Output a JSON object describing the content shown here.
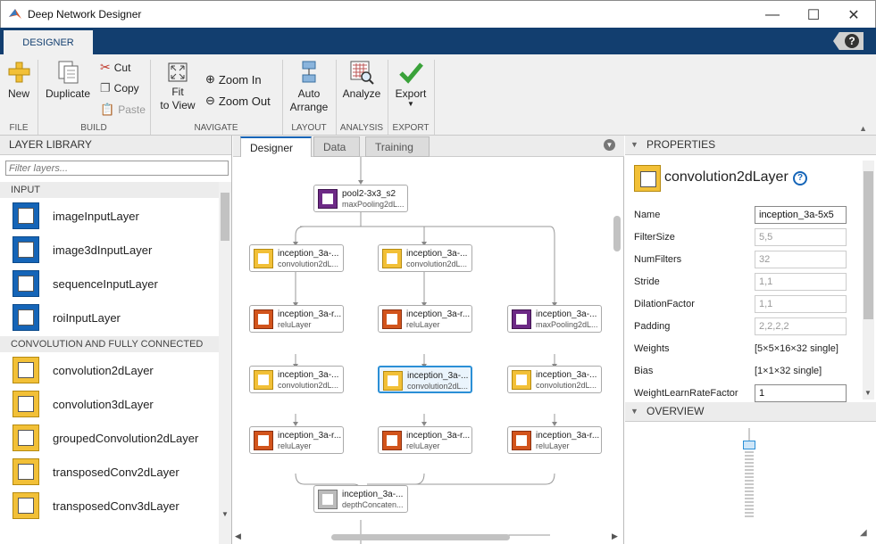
{
  "window": {
    "title": "Deep Network Designer",
    "min": "—",
    "max": "☐",
    "close": "✕"
  },
  "ribbon": {
    "tab": "DESIGNER",
    "help": "?",
    "file": {
      "new": "New",
      "section": "FILE"
    },
    "build": {
      "duplicate": "Duplicate",
      "cut": "Cut",
      "copy": "Copy",
      "paste": "Paste",
      "section": "BUILD"
    },
    "navigate": {
      "fit1": "Fit",
      "fit2": "to View",
      "zoom_in": "Zoom In",
      "zoom_out": "Zoom Out",
      "section": "NAVIGATE"
    },
    "layout": {
      "auto1": "Auto",
      "auto2": "Arrange",
      "section": "LAYOUT"
    },
    "analysis": {
      "analyze": "Analyze",
      "section": "ANALYSIS"
    },
    "export": {
      "export": "Export",
      "section": "EXPORT"
    }
  },
  "library": {
    "header": "LAYER LIBRARY",
    "filter_placeholder": "Filter layers...",
    "categories": [
      {
        "name": "INPUT"
      },
      {
        "name": "CONVOLUTION AND FULLY CONNECTED"
      }
    ],
    "items": [
      {
        "label": "imageInputLayer",
        "color": "blue"
      },
      {
        "label": "image3dInputLayer",
        "color": "blue"
      },
      {
        "label": "sequenceInputLayer",
        "color": "blue"
      },
      {
        "label": "roiInputLayer",
        "color": "blue"
      },
      {
        "label": "convolution2dLayer",
        "color": "yellow"
      },
      {
        "label": "convolution3dLayer",
        "color": "yellow"
      },
      {
        "label": "groupedConvolution2dLayer",
        "color": "yellow"
      },
      {
        "label": "transposedConv2dLayer",
        "color": "yellow"
      },
      {
        "label": "transposedConv3dLayer",
        "color": "yellow"
      }
    ]
  },
  "canvas": {
    "tabs": [
      {
        "label": "Designer"
      },
      {
        "label": "Data"
      },
      {
        "label": "Training"
      }
    ],
    "nodes": [
      {
        "name": "pool2-3x3_s2",
        "type": "maxPooling2dL...",
        "kind": "pool"
      },
      {
        "name": "inception_3a-...",
        "type": "convolution2dL...",
        "kind": "conv"
      },
      {
        "name": "inception_3a-...",
        "type": "convolution2dL...",
        "kind": "conv"
      },
      {
        "name": "inception_3a-r...",
        "type": "reluLayer",
        "kind": "relu"
      },
      {
        "name": "inception_3a-r...",
        "type": "reluLayer",
        "kind": "relu"
      },
      {
        "name": "inception_3a-...",
        "type": "maxPooling2dL...",
        "kind": "pool"
      },
      {
        "name": "inception_3a-...",
        "type": "convolution2dL...",
        "kind": "conv"
      },
      {
        "name": "inception_3a-...",
        "type": "convolution2dL...",
        "kind": "conv",
        "selected": true
      },
      {
        "name": "inception_3a-...",
        "type": "convolution2dL...",
        "kind": "conv"
      },
      {
        "name": "inception_3a-r...",
        "type": "reluLayer",
        "kind": "relu"
      },
      {
        "name": "inception_3a-r...",
        "type": "reluLayer",
        "kind": "relu"
      },
      {
        "name": "inception_3a-r...",
        "type": "reluLayer",
        "kind": "relu"
      },
      {
        "name": "inception_3a-...",
        "type": "depthConcaten...",
        "kind": "concat"
      }
    ]
  },
  "properties": {
    "header": "PROPERTIES",
    "layer_type": "convolution2dLayer",
    "rows": [
      {
        "label": "Name",
        "value": "inception_3a-5x5",
        "style": "edit"
      },
      {
        "label": "FilterSize",
        "value": "5,5",
        "style": "disabled"
      },
      {
        "label": "NumFilters",
        "value": "32",
        "style": "disabled"
      },
      {
        "label": "Stride",
        "value": "1,1",
        "style": "disabled"
      },
      {
        "label": "DilationFactor",
        "value": "1,1",
        "style": "disabled"
      },
      {
        "label": "Padding",
        "value": "2,2,2,2",
        "style": "disabled"
      },
      {
        "label": "Weights",
        "value": "[5×5×16×32 single]",
        "style": "text"
      },
      {
        "label": "Bias",
        "value": "[1×1×32 single]",
        "style": "text"
      },
      {
        "label": "WeightLearnRateFactor",
        "value": "1",
        "style": "edit"
      }
    ]
  },
  "overview": {
    "header": "OVERVIEW"
  },
  "colors": {
    "accent": "#123e6f",
    "selection": "#2b8fd6",
    "conv": "#f2c037",
    "relu": "#d2541c",
    "pool": "#6d2a86",
    "input": "#1565b8"
  }
}
